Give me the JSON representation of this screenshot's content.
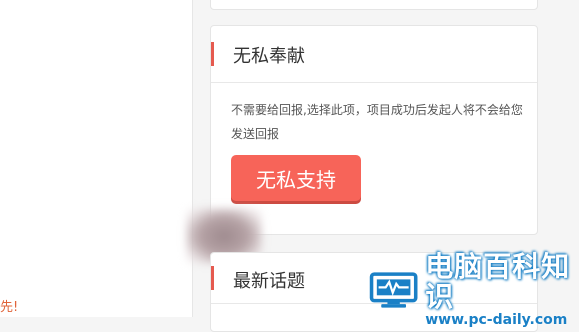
{
  "left_pane": {
    "snippet": "先!"
  },
  "selfless_card": {
    "title": "无私奉献",
    "description": "不需要给回报,选择此项，项目成功后发起人将不会给您发送回报",
    "button_label": "无私支持"
  },
  "topics_card": {
    "title": "最新话题"
  },
  "watermark": {
    "title": "电脑百科知识",
    "url": "www.pc-daily.com",
    "logo_icon": "monitor-heartbeat-icon"
  },
  "colors": {
    "accent": "#e55a4f",
    "button": "#f76459",
    "watermark_blue": "#1a80c6"
  }
}
